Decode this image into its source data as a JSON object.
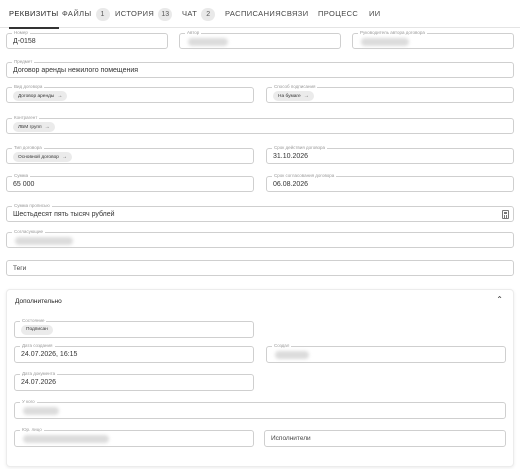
{
  "tabs": [
    {
      "label": "РЕКВИЗИТЫ",
      "active": true
    },
    {
      "label": "ФАЙЛЫ",
      "badge": "1"
    },
    {
      "label": "ИСТОРИЯ",
      "badge": "13"
    },
    {
      "label": "ЧАТ",
      "badge": "2"
    },
    {
      "label": "РАСПИСАНИЯ"
    },
    {
      "label": "СВЯЗИ"
    },
    {
      "label": "ПРОЦЕСС"
    },
    {
      "label": "ИИ"
    }
  ],
  "form": {
    "number": {
      "label": "Номер",
      "value": "Д-0158"
    },
    "author": {
      "label": "Автор"
    },
    "author_manager": {
      "label": "Руководитель автора договора"
    },
    "subject": {
      "label": "Предмет",
      "value": "Договор аренды нежилого помещения"
    },
    "contract_kind": {
      "label": "Вид договора",
      "value": "Договор аренды"
    },
    "signing_method": {
      "label": "Способ подписания",
      "value": "На бумаге"
    },
    "counterparty": {
      "label": "Контрагент",
      "value": "ЛБМ групп"
    },
    "contract_type": {
      "label": "Тип договора",
      "value": "Основной договор"
    },
    "term": {
      "label": "Срок действия договора",
      "value": "31.10.2026"
    },
    "amount": {
      "label": "Сумма",
      "value": "65 000"
    },
    "signing_date": {
      "label": "Срок согласования договора",
      "value": "06.08.2026"
    },
    "amount_words": {
      "label": "Сумма прописью",
      "value": "Шестьдесят пять тысяч рублей"
    },
    "approvers": {
      "label": "Согласующие"
    },
    "tags": {
      "placeholder": "Теги"
    }
  },
  "extra": {
    "title": "Дополнительно",
    "state": {
      "label": "Состояние",
      "value": "Подписан"
    },
    "created": {
      "label": "Дата создания",
      "value": "24.07.2026, 16:15"
    },
    "creator": {
      "label": "Создал"
    },
    "doc_date": {
      "label": "Дата документа",
      "value": "24.07.2026"
    },
    "holder": {
      "label": "У кого"
    },
    "legal_entity": {
      "label": "Юр. лицо"
    },
    "executors": {
      "placeholder": "Исполнители"
    }
  }
}
